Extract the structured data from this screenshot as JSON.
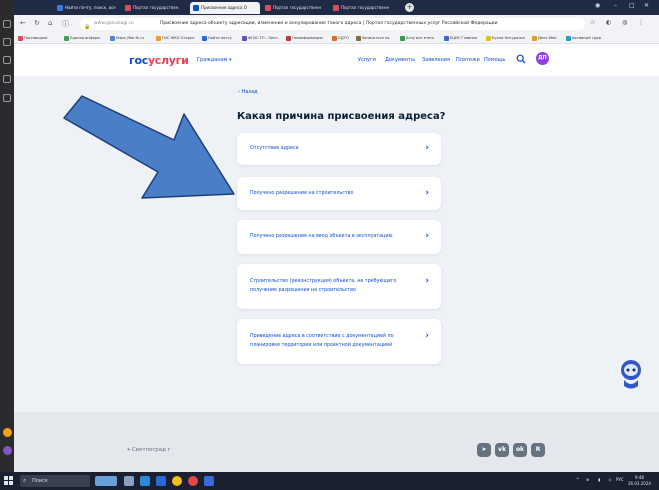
{
  "browser": {
    "tabs": [
      {
        "label": "Найти почту, поиск, все",
        "active": false
      },
      {
        "label": "Портал государствен",
        "active": false
      },
      {
        "label": "Присвоение адреса О",
        "active": true
      },
      {
        "label": "Портал государственн",
        "active": false
      },
      {
        "label": "Портал государственн",
        "active": false
      }
    ],
    "url_host": "www.gosuslugi.ru",
    "page_title": "Присвоение адреса объекту адресации, изменение и аннулирование такого адреса | Портал государственных услуг Российской Федерации",
    "bookmarks": [
      "Поставщики",
      "Единая информ.",
      "https://fiar.fk.ru",
      "ГИС ЖКХ Открыт",
      "Найти почту",
      "ФГИС ТП - Личн.",
      "Геоинформацио",
      "ОДТО",
      "Записаться на",
      "Хочу все знать",
      "ЕЦИС Главная",
      "Кухни Натуральн",
      "Дело Web",
      "Активный граж"
    ]
  },
  "site": {
    "logo_part1": "гос",
    "logo_part2": "услуги",
    "citizen_menu": "Гражданам ▾",
    "nav": [
      "Услуги",
      "Документы",
      "Заявления",
      "Платежи",
      "Помощь"
    ],
    "avatar_initials": "ДП"
  },
  "main": {
    "back_link": "‹ Назад",
    "question": "Какая причина присвоения адреса?",
    "options": [
      {
        "label": "Отсутствие адреса"
      },
      {
        "label": "Получено разрешение на строительство"
      },
      {
        "label": "Получено разрешение на ввод объекта в эксплуатацию"
      },
      {
        "label": "Строительство (реконструкция) объекта, не требующего получение разрешения на строительство"
      },
      {
        "label": "Приведение адреса в соответствие с документацией по планировке территории или проектной документацией"
      }
    ]
  },
  "footer": {
    "city": "Светлоград г",
    "social": [
      "telegram-icon",
      "vk-icon",
      "ok-icon",
      "rutube-icon"
    ]
  },
  "taskbar": {
    "search_label": "Поиск",
    "lang": "РУС",
    "time": "9:48",
    "date": "26.03.2024"
  },
  "colors": {
    "brand_blue": "#0d4cd3",
    "brand_red": "#ee3f58",
    "page_bg": "#eef1f6",
    "arrow_fill": "#4a7fc8",
    "avatar": "#8f3ee8"
  }
}
